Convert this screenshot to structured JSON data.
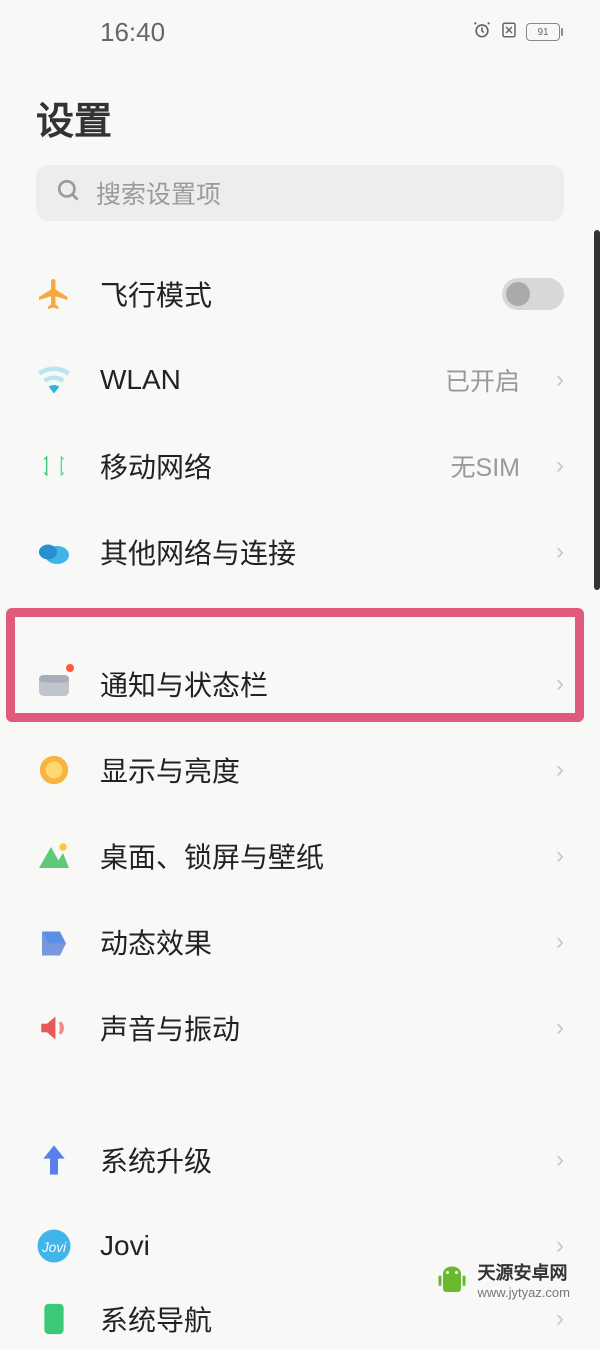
{
  "status_bar": {
    "time": "16:40",
    "battery": "91"
  },
  "page": {
    "title": "设置"
  },
  "search": {
    "placeholder": "搜索设置项"
  },
  "items": {
    "airplane": {
      "label": "飞行模式"
    },
    "wlan": {
      "label": "WLAN",
      "value": "已开启"
    },
    "mobile": {
      "label": "移动网络",
      "value": "无SIM"
    },
    "other_net": {
      "label": "其他网络与连接"
    },
    "notification": {
      "label": "通知与状态栏"
    },
    "display": {
      "label": "显示与亮度"
    },
    "desktop": {
      "label": "桌面、锁屏与壁纸"
    },
    "effects": {
      "label": "动态效果"
    },
    "sound": {
      "label": "声音与振动"
    },
    "update": {
      "label": "系统升级"
    },
    "jovi": {
      "label": "Jovi"
    },
    "navigation": {
      "label": "系统导航"
    }
  },
  "watermark": {
    "name": "天源安卓网",
    "url": "www.jytyaz.com"
  }
}
